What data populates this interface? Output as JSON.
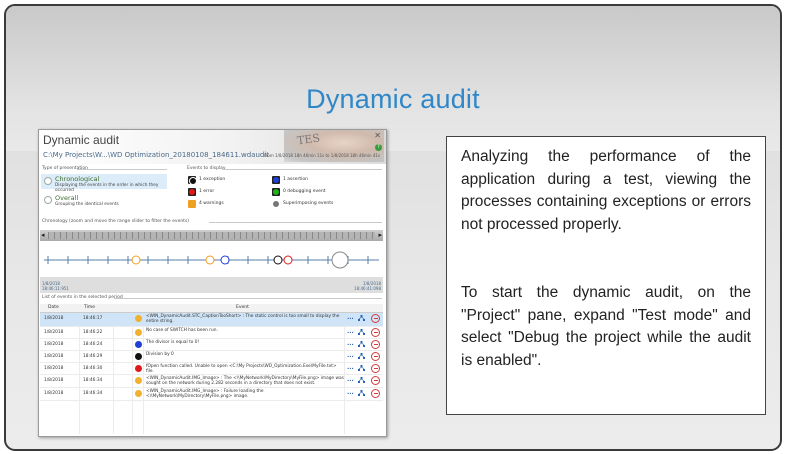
{
  "slide": {
    "title": "Dynamic audit"
  },
  "window": {
    "title": "Dynamic audit",
    "path": "C:\\My Projects\\W...\\WD Optimization_20180108_184611.wdaudit",
    "range": "From 1/8/2018 18h 46min 11s to 1/8/2018 18h 46min 41s",
    "background_text": "TES",
    "presentation_header": "Type of presentation",
    "presentation": [
      {
        "label": "Chronological",
        "desc": "Displaying the events in the order in which they occurred",
        "selected": true
      },
      {
        "label": "Overall",
        "desc": "Grouping the identical events",
        "selected": false
      }
    ],
    "events_header": "Events to display",
    "events": [
      {
        "label": "1 exception",
        "color": "#111111"
      },
      {
        "label": "1 assertion",
        "color": "#1f3fd6"
      },
      {
        "label": "1 error",
        "color": "#e01818"
      },
      {
        "label": "0 debugging event",
        "color": "#21b021"
      },
      {
        "label": "4 warnings",
        "color": "#f0a020"
      },
      {
        "label": "Superimposing events",
        "color": "#777777"
      }
    ],
    "chronology_header": "Chronology (zoom and move the range slider to filter the events)",
    "timeline_start": {
      "date": "1/8/2018",
      "time": "18:46:11:951"
    },
    "timeline_end": {
      "date": "1/8/2018",
      "time": "18:46:41:098"
    },
    "list_header": "List of events in the selected period",
    "columns": {
      "date": "Date",
      "time": "Time",
      "event": "Event"
    },
    "rows": [
      {
        "date": "1/8/2018",
        "time": "18:46:17",
        "color": "#f0b030",
        "event": "<WIN_DynamicAudit.STC_CaptionTooShort> : The static control is too small to display the entire string.",
        "selected": true
      },
      {
        "date": "1/8/2018",
        "time": "18:46:22",
        "color": "#f0b030",
        "event": "No case of SWITCH has been run.",
        "selected": false
      },
      {
        "date": "1/8/2018",
        "time": "18:46:24",
        "color": "#1f3fd6",
        "event": "The divisor is equal to 0!",
        "selected": false
      },
      {
        "date": "1/8/2018",
        "time": "18:46:29",
        "color": "#111111",
        "event": "Division by 0",
        "selected": false
      },
      {
        "date": "1/8/2018",
        "time": "18:46:30",
        "color": "#e01818",
        "event": "fOpen function called. Unable to open <C:\\My Projects\\WD_Optimization.Exe\\MyFile.txt> file.",
        "selected": false
      },
      {
        "date": "1/8/2018",
        "time": "18:46:34",
        "color": "#f0b030",
        "event": "<WIN_DynamicAudit.IMG_Image> : The <\\\\MyNetwork\\MyDirectory\\MyFile.png> image was sought on the network during 2.282 seconds in a directory that does not exist.",
        "selected": false
      },
      {
        "date": "1/8/2018",
        "time": "18:46:34",
        "color": "#f0b030",
        "event": "<WIN_DynamicAudit.IMG_Image> : Failure loading the <\\\\MyNetwork\\MyDirectory\\MyFile.png> image.",
        "selected": false
      }
    ],
    "more_label": "..."
  },
  "description": {
    "p1": "Analyzing the performance of the application during a test, viewing the processes containing exceptions or errors not processed properly.",
    "p2": "To start the dynamic audit, on the \"Project\" pane, expand \"Test mode\" and select \"Debug the project while the audit is enabled\"."
  }
}
